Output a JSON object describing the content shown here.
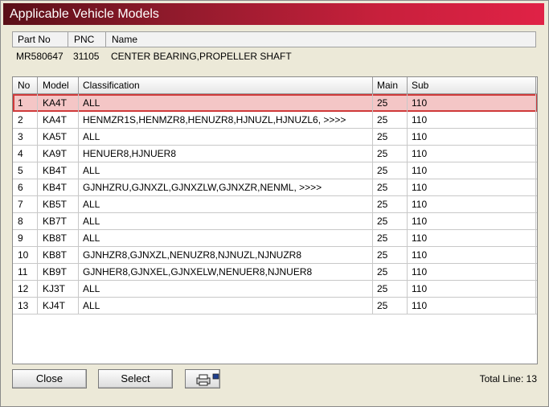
{
  "window": {
    "title": "Applicable Vehicle Models"
  },
  "part": {
    "headers": [
      "Part No",
      "PNC",
      "Name"
    ],
    "part_no": "MR580647",
    "pnc": "31105",
    "name": "CENTER BEARING,PROPELLER SHAFT"
  },
  "table": {
    "columns": [
      "No",
      "Model",
      "Classification",
      "Main",
      "Sub"
    ],
    "rows": [
      {
        "no": "1",
        "model": "KA4T",
        "classification": "ALL",
        "main": "25",
        "sub": "110"
      },
      {
        "no": "2",
        "model": "KA4T",
        "classification": "HENMZR1S,HENMZR8,HENUZR8,HJNUZL,HJNUZL6,  >>>>",
        "main": "25",
        "sub": "110"
      },
      {
        "no": "3",
        "model": "KA5T",
        "classification": "ALL",
        "main": "25",
        "sub": "110"
      },
      {
        "no": "4",
        "model": "KA9T",
        "classification": "HENUER8,HJNUER8",
        "main": "25",
        "sub": "110"
      },
      {
        "no": "5",
        "model": "KB4T",
        "classification": "ALL",
        "main": "25",
        "sub": "110"
      },
      {
        "no": "6",
        "model": "KB4T",
        "classification": "GJNHZRU,GJNXZL,GJNXZLW,GJNXZR,NENML,  >>>>",
        "main": "25",
        "sub": "110"
      },
      {
        "no": "7",
        "model": "KB5T",
        "classification": "ALL",
        "main": "25",
        "sub": "110"
      },
      {
        "no": "8",
        "model": "KB7T",
        "classification": "ALL",
        "main": "25",
        "sub": "110"
      },
      {
        "no": "9",
        "model": "KB8T",
        "classification": "ALL",
        "main": "25",
        "sub": "110"
      },
      {
        "no": "10",
        "model": "KB8T",
        "classification": "GJNHZR8,GJNXZL,NENUZR8,NJNUZL,NJNUZR8",
        "main": "25",
        "sub": "110"
      },
      {
        "no": "11",
        "model": "KB9T",
        "classification": "GJNHER8,GJNXEL,GJNXELW,NENUER8,NJNUER8",
        "main": "25",
        "sub": "110"
      },
      {
        "no": "12",
        "model": "KJ3T",
        "classification": "ALL",
        "main": "25",
        "sub": "110"
      },
      {
        "no": "13",
        "model": "KJ4T",
        "classification": "ALL",
        "main": "25",
        "sub": "110"
      }
    ]
  },
  "buttons": {
    "close": "Close",
    "select": "Select",
    "print_icon": "printer-icon"
  },
  "footer": {
    "total": "Total Line: 13"
  },
  "colors": {
    "title_start": "#5a0f17",
    "title_end": "#e02246",
    "selected_row": "#f4c6c6",
    "selected_border": "#d03a3a"
  }
}
